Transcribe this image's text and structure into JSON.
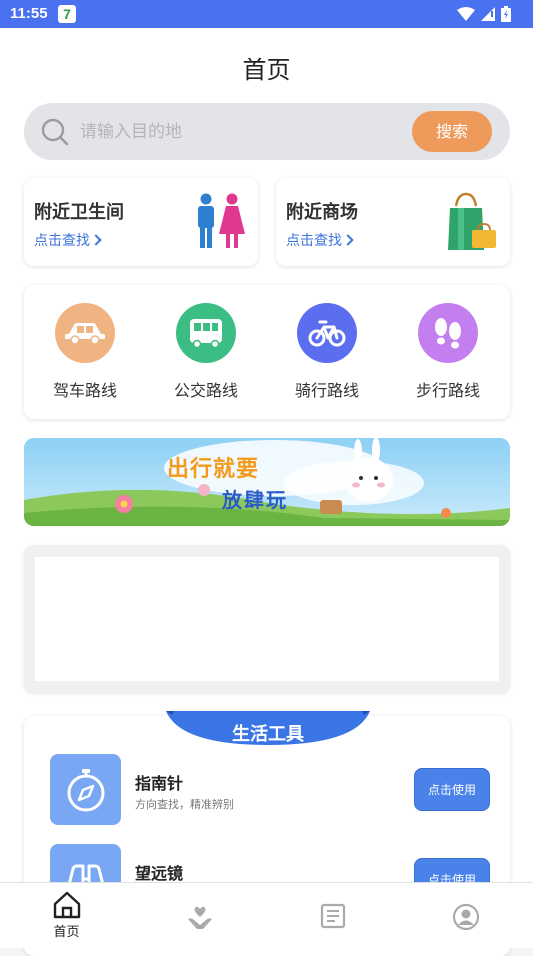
{
  "status_bar": {
    "time": "11:55",
    "app_badge": "7"
  },
  "header": {
    "title": "首页"
  },
  "search": {
    "placeholder": "请输入目的地",
    "button_label": "搜索"
  },
  "nearby": [
    {
      "title": "附近卫生间",
      "link": "点击查找"
    },
    {
      "title": "附近商场",
      "link": "点击查找"
    }
  ],
  "routes": [
    {
      "label": "驾车路线",
      "icon": "car-icon",
      "color": "#f0b483"
    },
    {
      "label": "公交路线",
      "icon": "bus-icon",
      "color": "#3bbd84"
    },
    {
      "label": "骑行路线",
      "icon": "bike-icon",
      "color": "#5c6ef0"
    },
    {
      "label": "步行路线",
      "icon": "footprints-icon",
      "color": "#c37ef0"
    }
  ],
  "banner": {
    "line1": "出行就要",
    "line2": "放肆玩"
  },
  "tools": {
    "title": "生活工具",
    "items": [
      {
        "name": "指南针",
        "desc": "方向查找，精准辨别",
        "button": "点击使用",
        "icon": "compass-icon"
      },
      {
        "name": "望远镜",
        "desc": "",
        "button": "点击使用",
        "icon": "binoculars-icon"
      }
    ]
  },
  "tabbar": {
    "items": [
      {
        "label": "首页",
        "icon": "home-icon",
        "active": true
      },
      {
        "label": "",
        "icon": "heart-hand-icon"
      },
      {
        "label": "",
        "icon": "news-icon"
      },
      {
        "label": "",
        "icon": "user-icon"
      }
    ]
  },
  "colors": {
    "accent": "#4a72f0",
    "search_button": "#ee9a5a",
    "link": "#3c73e0",
    "tool_button": "#4a82ea"
  }
}
